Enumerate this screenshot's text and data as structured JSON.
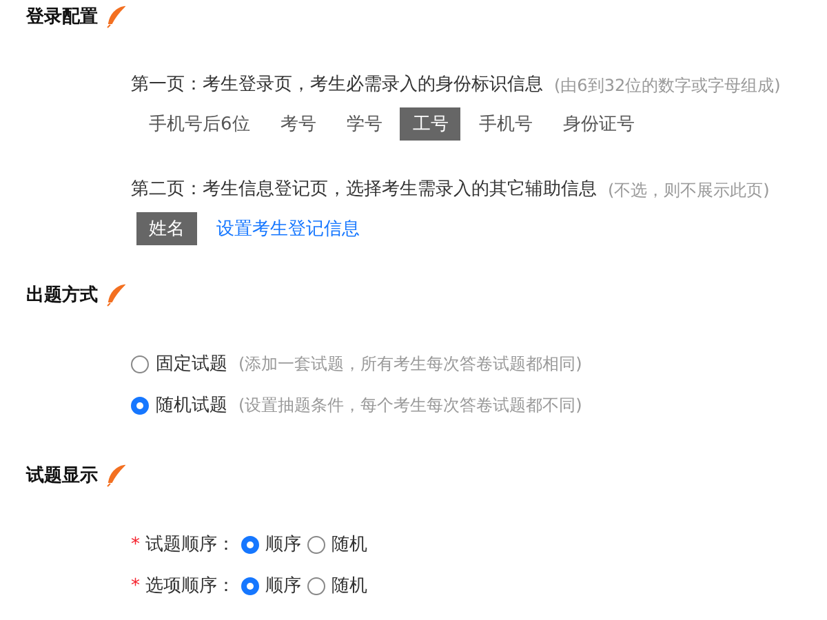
{
  "sections": [
    {
      "kind": "login",
      "title": "登录配置",
      "pages": [
        {
          "label": "第一页：考生登录页，考生必需录入的身份标识信息",
          "hint": "(由6到32位的数字或字母组成)",
          "options": [
            {
              "label": "手机号后6位",
              "selected": false
            },
            {
              "label": "考号",
              "selected": false
            },
            {
              "label": "学号",
              "selected": false
            },
            {
              "label": "工号",
              "selected": true
            },
            {
              "label": "手机号",
              "selected": false
            },
            {
              "label": "身份证号",
              "selected": false
            }
          ]
        },
        {
          "label": "第二页：考生信息登记页，选择考生需录入的其它辅助信息",
          "hint": "(不选，则不展示此页)",
          "options": [
            {
              "label": "姓名",
              "selected": true
            }
          ],
          "link": "设置考生登记信息"
        }
      ]
    },
    {
      "kind": "choice",
      "title": "出题方式",
      "options": [
        {
          "label": "固定试题",
          "hint": "(添加一套试题，所有考生每次答卷试题都相同)",
          "selected": false
        },
        {
          "label": "随机试题",
          "hint": "(设置抽题条件，每个考生每次答卷试题都不同)",
          "selected": true
        }
      ]
    },
    {
      "kind": "settings",
      "title": "试题显示",
      "rows": [
        {
          "label": "试题顺序：",
          "mark": "*",
          "options": [
            {
              "label": "顺序",
              "selected": true
            },
            {
              "label": "随机",
              "selected": false
            }
          ]
        },
        {
          "label": "选项顺序：",
          "mark": "*",
          "options": [
            {
              "label": "顺序",
              "selected": true
            },
            {
              "label": "随机",
              "selected": false
            }
          ]
        }
      ]
    }
  ]
}
